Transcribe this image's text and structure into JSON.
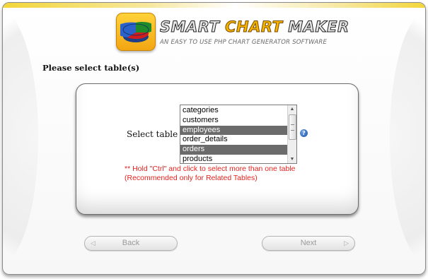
{
  "header": {
    "logo_word1": "SMART",
    "logo_word2": "CHART",
    "logo_word3": "MAKER",
    "tagline": "AN EASY TO USE PHP CHART GENERATOR SOFTWARE"
  },
  "page": {
    "heading": "Please select table(s)"
  },
  "form": {
    "select_label": "Select table",
    "tables": [
      {
        "name": "categories",
        "selected": false
      },
      {
        "name": "customers",
        "selected": false
      },
      {
        "name": "employees",
        "selected": true
      },
      {
        "name": "order_details",
        "selected": false
      },
      {
        "name": "orders",
        "selected": true
      },
      {
        "name": "products",
        "selected": false
      }
    ],
    "help_glyph": "?",
    "note": "** Hold \"Ctrl\" and click to select more than one table (Recommended only for Related Tables)"
  },
  "nav": {
    "back_label": "Back",
    "next_label": "Next",
    "back_arrow": "◁",
    "next_arrow": "▷"
  },
  "colors": {
    "selected_row": "#6b6b6b",
    "note_text": "#e8221e",
    "logo_accent": "#f5b400",
    "top_strip": "#f3d63a"
  }
}
